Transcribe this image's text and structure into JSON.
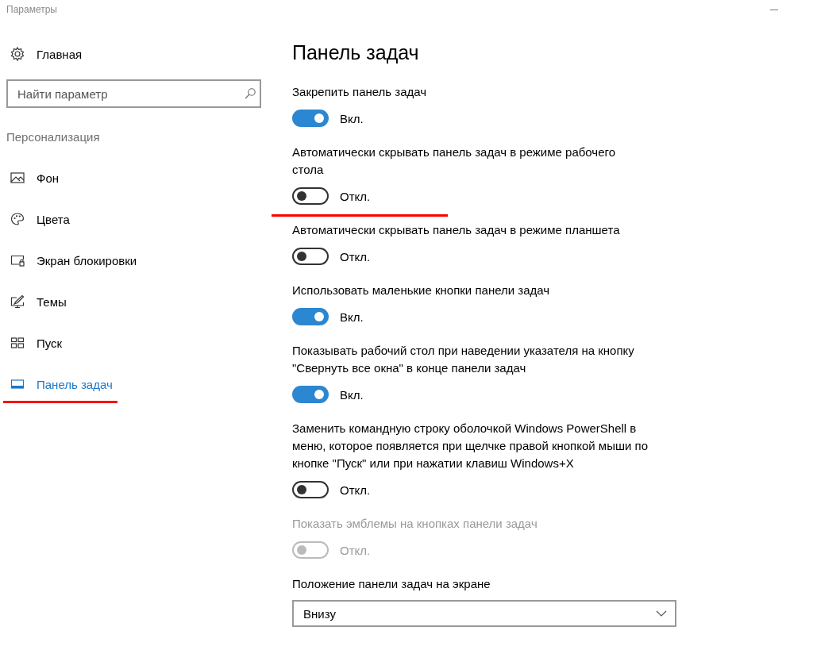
{
  "window": {
    "title": "Параметры"
  },
  "sidebar": {
    "home": "Главная",
    "search": {
      "placeholder": "Найти параметр"
    },
    "section": "Персонализация",
    "items": [
      {
        "label": "Фон",
        "selected": false,
        "underlined": false
      },
      {
        "label": "Цвета",
        "selected": false,
        "underlined": false
      },
      {
        "label": "Экран блокировки",
        "selected": false,
        "underlined": false
      },
      {
        "label": "Темы",
        "selected": false,
        "underlined": false
      },
      {
        "label": "Пуск",
        "selected": false,
        "underlined": false
      },
      {
        "label": "Панель задач",
        "selected": true,
        "underlined": true
      }
    ]
  },
  "page": {
    "title": "Панель задач",
    "settings": [
      {
        "kind": "toggle",
        "label": "Закрепить панель задач",
        "on": true,
        "state": "Вкл.",
        "disabled": false,
        "underlined": false
      },
      {
        "kind": "toggle",
        "label": "Автоматически скрывать панель задач в режиме рабочего стола",
        "on": false,
        "state": "Откл.",
        "disabled": false,
        "underlined": true
      },
      {
        "kind": "toggle",
        "label": "Автоматически скрывать панель задач в режиме планшета",
        "on": false,
        "state": "Откл.",
        "disabled": false,
        "underlined": false
      },
      {
        "kind": "toggle",
        "label": "Использовать маленькие кнопки панели задач",
        "on": true,
        "state": "Вкл.",
        "disabled": false,
        "underlined": false
      },
      {
        "kind": "toggle",
        "label": "Показывать рабочий стол при наведении указателя на кнопку \"Свернуть все окна\" в конце панели задач",
        "on": true,
        "state": "Вкл.",
        "disabled": false,
        "underlined": false
      },
      {
        "kind": "toggle",
        "label": "Заменить командную строку оболочкой Windows PowerShell в меню, которое появляется при щелчке правой кнопкой мыши по кнопке \"Пуск\" или при нажатии клавиш Windows+X",
        "on": false,
        "state": "Откл.",
        "disabled": false,
        "underlined": false
      },
      {
        "kind": "toggle",
        "label": "Показать эмблемы на кнопках панели задач",
        "on": false,
        "state": "Откл.",
        "disabled": true,
        "underlined": false
      },
      {
        "kind": "dropdown",
        "label": "Положение панели задач на экране",
        "value": "Внизу"
      }
    ]
  }
}
